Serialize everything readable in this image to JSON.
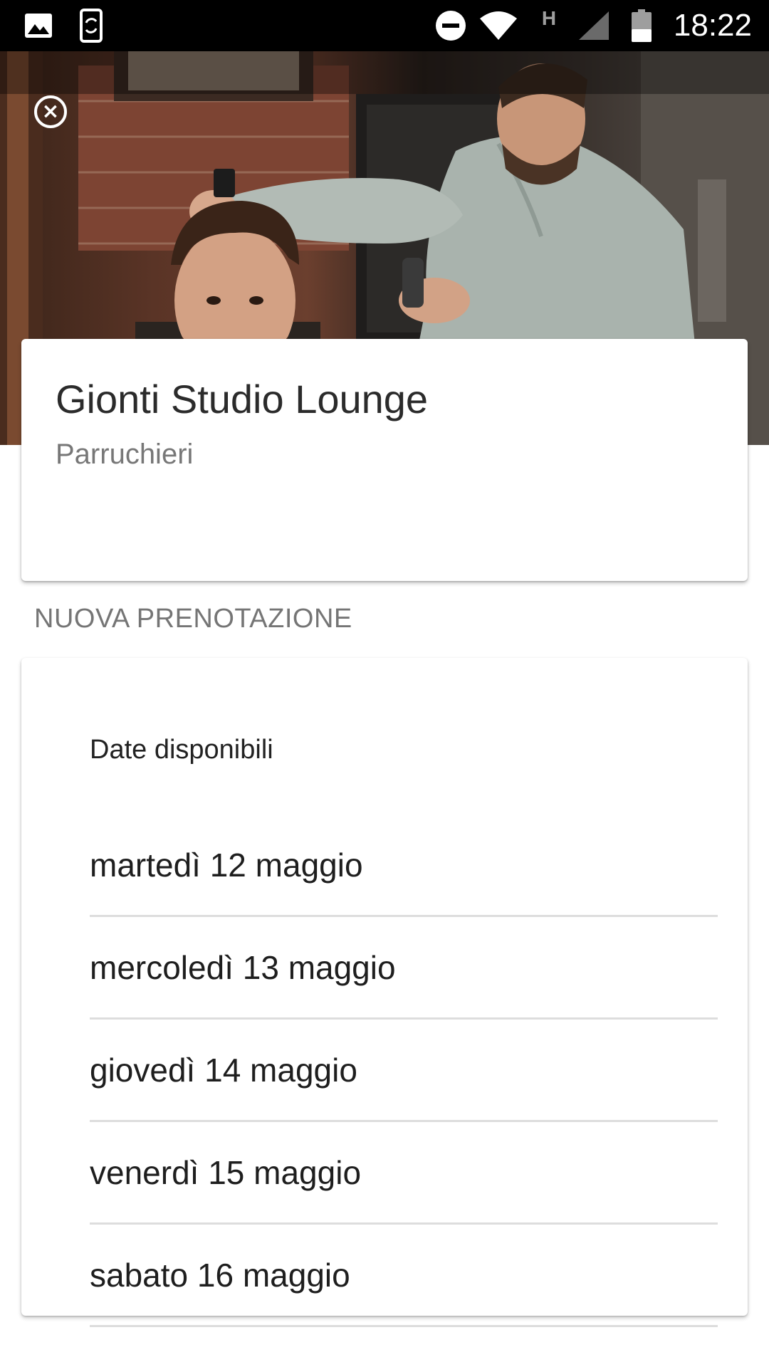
{
  "status_bar": {
    "time": "18:22",
    "network_label": "H",
    "icons": [
      "gallery-icon",
      "screen-rotation-icon",
      "do-not-disturb-icon",
      "wifi-icon",
      "cellular-signal-icon",
      "battery-icon"
    ]
  },
  "hero": {
    "close_icon": "close-circle-icon"
  },
  "business": {
    "name": "Gionti Studio Lounge",
    "category": "Parruchieri"
  },
  "booking": {
    "section_title": "NUOVA PRENOTAZIONE",
    "dates_label": "Date disponibili",
    "dates": [
      "martedì 12 maggio",
      "mercoledì 13 maggio",
      "giovedì 14 maggio",
      "venerdì 15 maggio",
      "sabato 16 maggio"
    ]
  }
}
